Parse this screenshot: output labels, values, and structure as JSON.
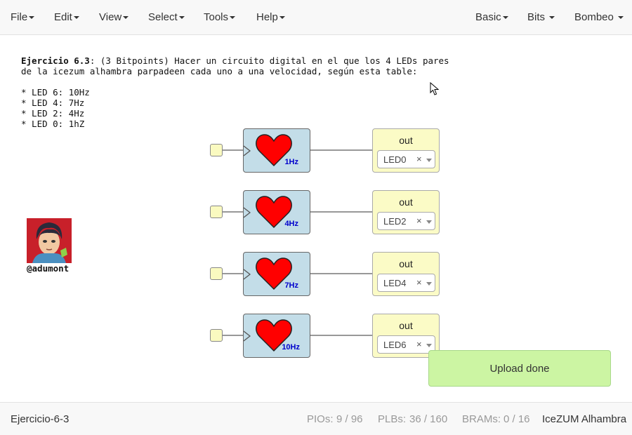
{
  "menubar": {
    "left": [
      "File",
      "Edit",
      "View",
      "Select",
      "Tools",
      "Help"
    ],
    "right": [
      "Basic",
      "Bits",
      "Bombeo"
    ]
  },
  "description": {
    "title": "Ejercicio 6.3",
    "intro": ": (3 Bitpoints) Hacer un circuito digital en el que los 4 LEDs pares",
    "line2": "de la icezum alhambra parpadeen cada uno a una velocidad, según esta table:",
    "items": [
      "* LED 6: 10Hz",
      "* LED 4: 7Hz",
      "* LED 2: 4Hz",
      "* LED 0: 1hZ"
    ]
  },
  "avatar": {
    "handle": "@adumont"
  },
  "circuit": {
    "rows": [
      {
        "freq": "1Hz",
        "out_label": "out",
        "pin": "LED0"
      },
      {
        "freq": "4Hz",
        "out_label": "out",
        "pin": "LED2"
      },
      {
        "freq": "7Hz",
        "out_label": "out",
        "pin": "LED4"
      },
      {
        "freq": "10Hz",
        "out_label": "out",
        "pin": "LED6"
      }
    ],
    "clear_glyph": "×"
  },
  "toast": {
    "message": "Upload done"
  },
  "footer": {
    "project": "Ejercicio-6-3",
    "pios_label": "PIOs:",
    "pios_value": "9 / 96",
    "plbs_label": "PLBs:",
    "plbs_value": "36 / 160",
    "brams_label": "BRAMs:",
    "brams_value": "0 / 16",
    "board": "IceZUM Alhambra"
  },
  "colors": {
    "block_fill": "#c3dde8",
    "output_fill": "#fbfbc6",
    "heart": "#ff0000",
    "freq_label": "#0000cc",
    "toast_fill": "#ccf5a3"
  }
}
